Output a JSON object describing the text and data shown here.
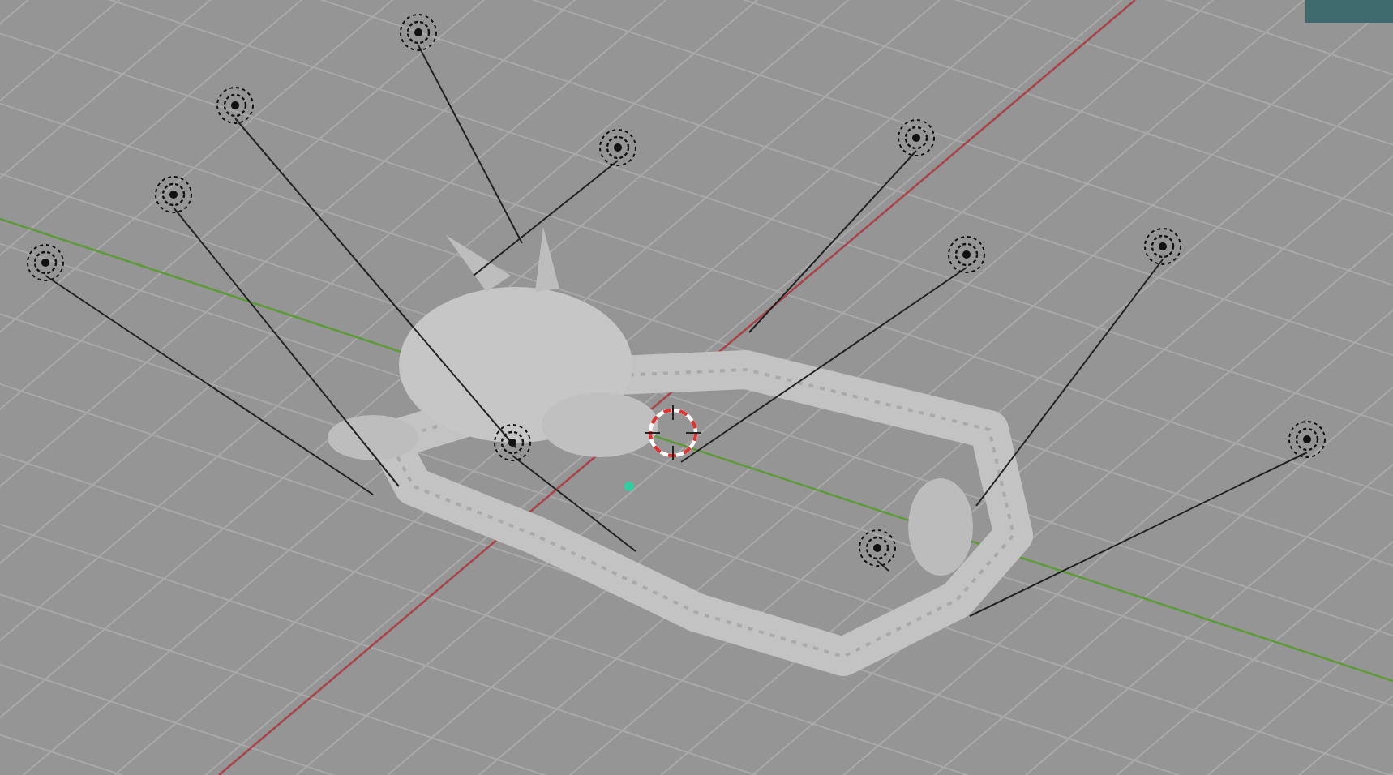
{
  "viewport": {
    "lights": [
      {
        "selected": false
      },
      {
        "selected": false
      },
      {
        "selected": false
      },
      {
        "selected": false
      },
      {
        "selected": false
      },
      {
        "selected": false
      },
      {
        "selected": false
      },
      {
        "selected": false
      },
      {
        "selected": false
      },
      {
        "selected": false
      },
      {
        "selected": false
      }
    ]
  }
}
